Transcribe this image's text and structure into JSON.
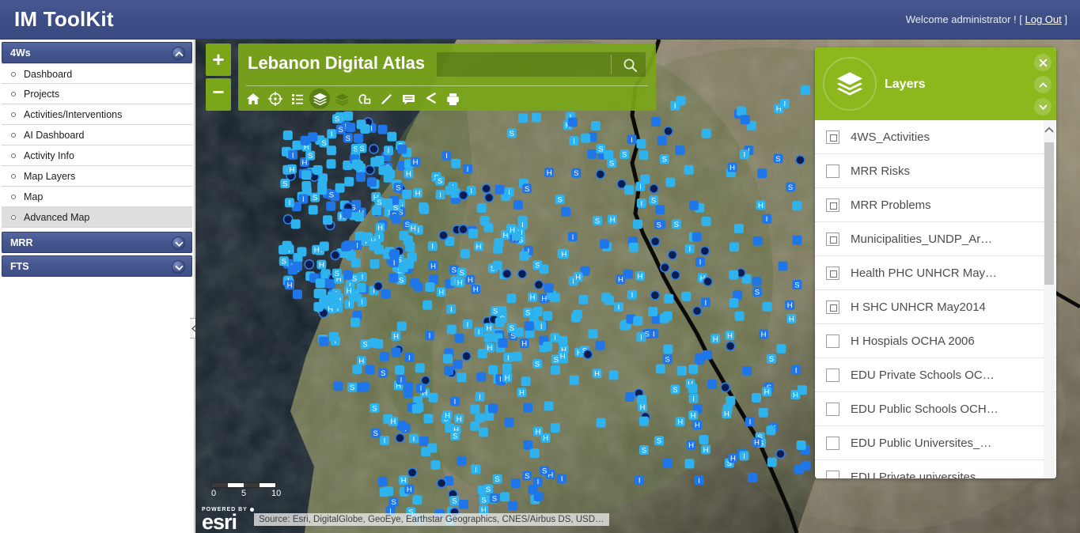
{
  "header": {
    "app_title": "IM ToolKit",
    "welcome_text": "Welcome administrator ! [ ",
    "logout_label": "Log Out",
    "welcome_suffix": " ]"
  },
  "sidebar": {
    "groups": [
      {
        "label": "4Ws",
        "expanded": true,
        "chevron": "chevron-up-icon",
        "items": [
          {
            "label": "Dashboard",
            "active": false
          },
          {
            "label": "Projects",
            "active": false
          },
          {
            "label": "Activities/Interventions",
            "active": false
          },
          {
            "label": "AI Dashboard",
            "active": false
          },
          {
            "label": "Activity Info",
            "active": false
          },
          {
            "label": "Map Layers",
            "active": false
          },
          {
            "label": "Map",
            "active": false
          },
          {
            "label": "Advanced Map",
            "active": true
          }
        ]
      },
      {
        "label": "MRR",
        "expanded": false,
        "chevron": "chevron-down-icon",
        "items": []
      },
      {
        "label": "FTS",
        "expanded": false,
        "chevron": "chevron-down-icon",
        "items": []
      }
    ],
    "collapse_handle": "collapse-left-icon"
  },
  "map": {
    "title": "Lebanon Digital Atlas",
    "search_value": "",
    "search_placeholder": "",
    "search_icon": "search-icon",
    "zoom_in_label": "+",
    "zoom_out_label": "−",
    "accent_color": "#7aa619",
    "panel_color": "#8cb81e",
    "tools": [
      {
        "name": "home-icon",
        "label": "Home",
        "active": false
      },
      {
        "name": "locate-icon",
        "label": "My Location",
        "active": false
      },
      {
        "name": "legend-icon",
        "label": "Legend",
        "active": false
      },
      {
        "name": "layers-icon",
        "label": "Layer List",
        "active": true
      },
      {
        "name": "basemap-gallery-icon",
        "label": "Basemap Gallery",
        "active": false
      },
      {
        "name": "measure-icon",
        "label": "Measurement",
        "active": false
      },
      {
        "name": "draw-icon",
        "label": "Draw",
        "active": false
      },
      {
        "name": "notes-icon",
        "label": "Notes",
        "active": false
      },
      {
        "name": "share-icon",
        "label": "Share",
        "active": false
      },
      {
        "name": "print-icon",
        "label": "Print",
        "active": false
      }
    ],
    "scalebar": {
      "ticks": [
        "0",
        "5",
        "10"
      ]
    },
    "attribution": "Source: Esri, DigitalGlobe, GeoEye, Earthstar Geographics, CNES/Airbus DS, USD…",
    "esri_powered_by": "POWERED BY",
    "esri_word": "esri"
  },
  "layers_panel": {
    "title": "Layers",
    "badge_icon": "layers-icon",
    "buttons": [
      {
        "name": "close-icon",
        "label": "Close"
      },
      {
        "name": "chevron-up-icon",
        "label": "Collapse"
      },
      {
        "name": "chevron-down-icon",
        "label": "Expand"
      }
    ],
    "scroll": {
      "up_icon": "chevron-up-icon"
    },
    "items": [
      {
        "label": "4WS_Activities",
        "state": "partial"
      },
      {
        "label": "MRR Risks",
        "state": "unchecked"
      },
      {
        "label": "MRR Problems",
        "state": "partial"
      },
      {
        "label": "Municipalities_UNDP_Ar…",
        "state": "partial"
      },
      {
        "label": "Health PHC UNHCR May…",
        "state": "partial"
      },
      {
        "label": "H SHC UNHCR May2014",
        "state": "partial"
      },
      {
        "label": "H Hospials OCHA 2006",
        "state": "unchecked"
      },
      {
        "label": "EDU Private Schools OC…",
        "state": "unchecked"
      },
      {
        "label": "EDU Public Schools OCH…",
        "state": "unchecked"
      },
      {
        "label": "EDU Public Universites_…",
        "state": "unchecked"
      },
      {
        "label": "EDU Private universites",
        "state": "unchecked"
      }
    ]
  }
}
